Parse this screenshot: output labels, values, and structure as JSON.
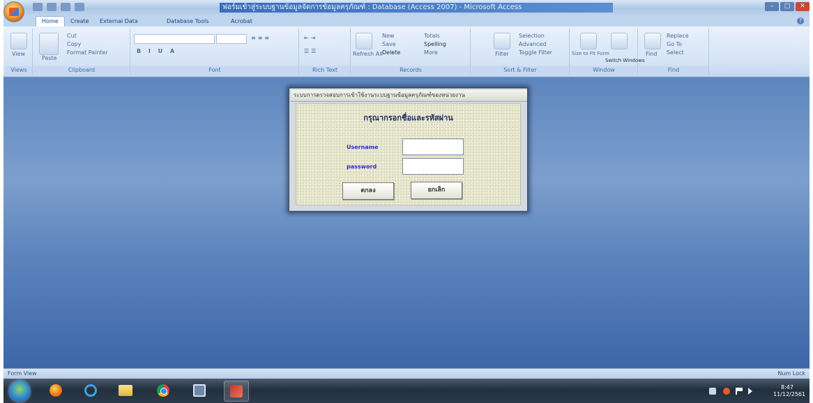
{
  "title_bar": {
    "window_title": "ฟอร์มเข้าสู่ระบบฐานข้อมูลจัดการข้อมูลครุภัณฑ์ : Database (Access 2007) - Microsoft Access",
    "minimize": "–",
    "maximize": "□",
    "close": "✕"
  },
  "ribbon": {
    "tabs": [
      {
        "label": "Home",
        "active": true
      },
      {
        "label": "Create",
        "active": false
      },
      {
        "label": "External Data",
        "active": false
      },
      {
        "label": "Database Tools",
        "active": false
      },
      {
        "label": "Acrobat",
        "active": false
      }
    ],
    "groups": {
      "views": {
        "label": "Views",
        "view_button": "View"
      },
      "clipboard": {
        "label": "Clipboard",
        "paste": "Paste",
        "cut": "Cut",
        "copy": "Copy",
        "format_painter": "Format Painter"
      },
      "font": {
        "label": "Font"
      },
      "rich_text": {
        "label": "Rich Text"
      },
      "records": {
        "label": "Records",
        "refresh_all": "Refresh All",
        "new": "New",
        "save": "Save",
        "delete": "Delete",
        "totals": "Totals",
        "spelling": "Spelling",
        "more": "More"
      },
      "sort_filter": {
        "label": "Sort & Filter",
        "filter": "Filter",
        "selection": "Selection",
        "advanced": "Advanced",
        "toggle_filter": "Toggle Filter"
      },
      "window": {
        "label": "Window",
        "size_to_fit": "Size to Fit Form",
        "switch_windows": "Switch Windows"
      },
      "find": {
        "label": "Find",
        "find": "Find",
        "replace": "Replace",
        "go_to": "Go To",
        "select": "Select"
      }
    }
  },
  "dialog": {
    "title": "ระบบการตรวจสอบการเข้าใช้งานระบบฐานข้อมูลครุภัณฑ์ของหน่วยงาน",
    "heading": "กรุณากรอกชื่อและรหัสผ่าน",
    "username_label": "Username",
    "password_label": "password",
    "username_value": "",
    "password_value": "",
    "ok_button": "ตกลง",
    "cancel_button": "ยกเลิก"
  },
  "status_bar": {
    "left": "Form View",
    "right": "Num Lock"
  },
  "taskbar": {
    "apps": [
      "start-orb",
      "firefox-icon",
      "internet-explorer-icon",
      "file-explorer-icon",
      "chrome-icon",
      "window-switcher-icon",
      "access-icon"
    ],
    "clock_time": "8:47",
    "clock_date": "11/12/2561"
  },
  "colors": {
    "client_bg": "#5d86bf",
    "dialog_bg": "#e8e8cf",
    "field_label": "#2a2ad8",
    "taskbar": "#232f3c"
  }
}
